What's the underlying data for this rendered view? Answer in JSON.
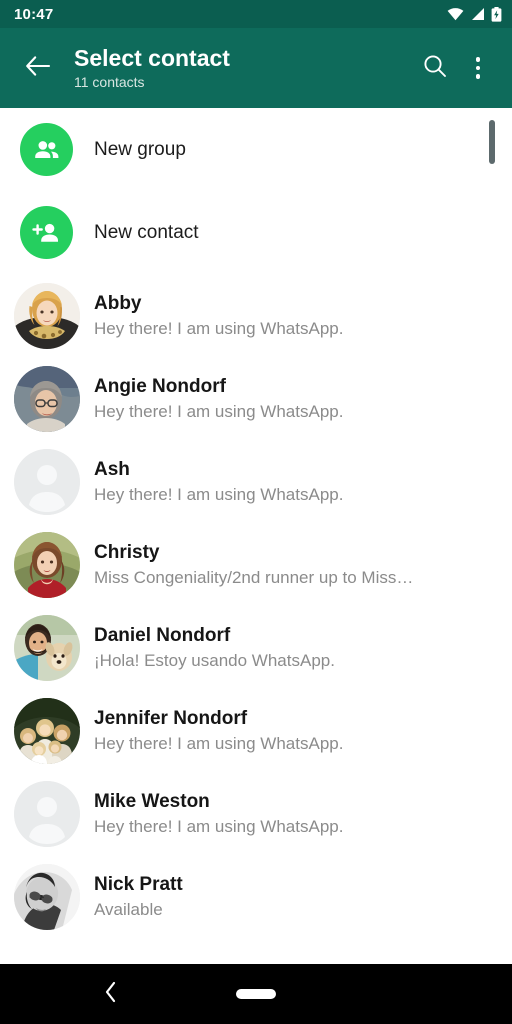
{
  "statusbar": {
    "time": "10:47",
    "icons": [
      "wifi-icon",
      "cellular-signal-icon",
      "battery-charging-icon"
    ]
  },
  "appbar": {
    "back_icon": "arrow-left-icon",
    "title": "Select contact",
    "subtitle": "11 contacts",
    "search_icon": "search-icon",
    "overflow_icon": "more-vertical-icon",
    "background_color": "#0e6b5b"
  },
  "actions": [
    {
      "label": "New group",
      "icon": "group-add-icon",
      "accent": "#25cf5f"
    },
    {
      "label": "New contact",
      "icon": "person-add-icon",
      "accent": "#25cf5f"
    }
  ],
  "contacts": [
    {
      "name": "Abby",
      "status": "Hey there! I am using WhatsApp.",
      "avatar": "photo"
    },
    {
      "name": "Angie Nondorf",
      "status": "Hey there! I am using WhatsApp.",
      "avatar": "photo"
    },
    {
      "name": "Ash",
      "status": "Hey there! I am using WhatsApp.",
      "avatar": "placeholder"
    },
    {
      "name": "Christy",
      "status": "Miss Congeniality/2nd runner up to Miss…",
      "avatar": "photo"
    },
    {
      "name": "Daniel Nondorf",
      "status": "¡Hola! Estoy usando WhatsApp.",
      "avatar": "photo"
    },
    {
      "name": "Jennifer Nondorf",
      "status": "Hey there! I am using WhatsApp.",
      "avatar": "photo"
    },
    {
      "name": "Mike Weston",
      "status": "Hey there! I am using WhatsApp.",
      "avatar": "placeholder"
    },
    {
      "name": "Nick Pratt",
      "status": "Available",
      "avatar": "photo"
    }
  ],
  "scrollbar": {
    "visible": true
  },
  "navbar": {
    "back_icon": "chevron-left-icon",
    "home_pill": "home-pill-indicator",
    "background_color": "#000000"
  }
}
